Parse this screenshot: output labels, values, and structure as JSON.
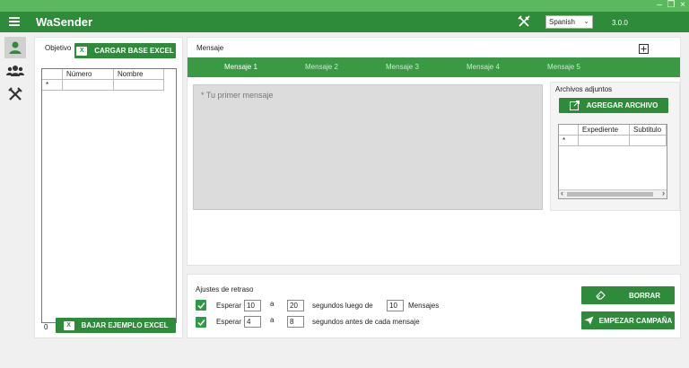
{
  "window": {
    "minimize": "–",
    "restore": "❐",
    "close": "×"
  },
  "app": {
    "title": "WaSender",
    "language": "Spanish",
    "version": "3.0.0"
  },
  "sidebar": {
    "items": [
      {
        "name": "user-icon",
        "active": true
      },
      {
        "name": "group-icon",
        "active": false
      },
      {
        "name": "tools-icon",
        "active": false
      }
    ]
  },
  "target": {
    "label": "Objetivo",
    "load_button": "CARGAR BASE EXCEL",
    "columns": [
      "Número",
      "Nombre"
    ],
    "row_marker": "*",
    "count": "0",
    "download_button": "BAJAR EJEMPLO EXCEL"
  },
  "message": {
    "label": "Mensaje",
    "add_icon": "plus-square-icon",
    "tabs": [
      "Mensaje 1",
      "Mensaje 2",
      "Mensaje 3",
      "Mensaje 4",
      "Mensaje 5"
    ],
    "active_tab": 0,
    "placeholder": "* Tu primer mensaje"
  },
  "attachments": {
    "label": "Archivos adjuntos",
    "add_button": "AGREGAR ARCHIVO",
    "columns": [
      "Expediente",
      "Subtitulo"
    ],
    "row_marker": "*",
    "scroll_left": "‹",
    "scroll_right": "›"
  },
  "delay": {
    "label": "Ajustes de retraso",
    "row1": {
      "checked": true,
      "wait": "Esperar",
      "from": "10",
      "sep": "a",
      "to": "20",
      "text": "segundos luego de",
      "count": "10",
      "suffix": "Mensajes"
    },
    "row2": {
      "checked": true,
      "wait": "Esperar",
      "from": "4",
      "sep": "a",
      "to": "8",
      "text": "segundos antes de cada mensaje"
    }
  },
  "actions": {
    "clear": "BORRAR",
    "start": "EMPEZAR CAMPAÑA"
  },
  "colors": {
    "title_bar": "#5bb85f",
    "app_bar": "#2e8b3a",
    "tab_bar": "#3a9a44"
  }
}
